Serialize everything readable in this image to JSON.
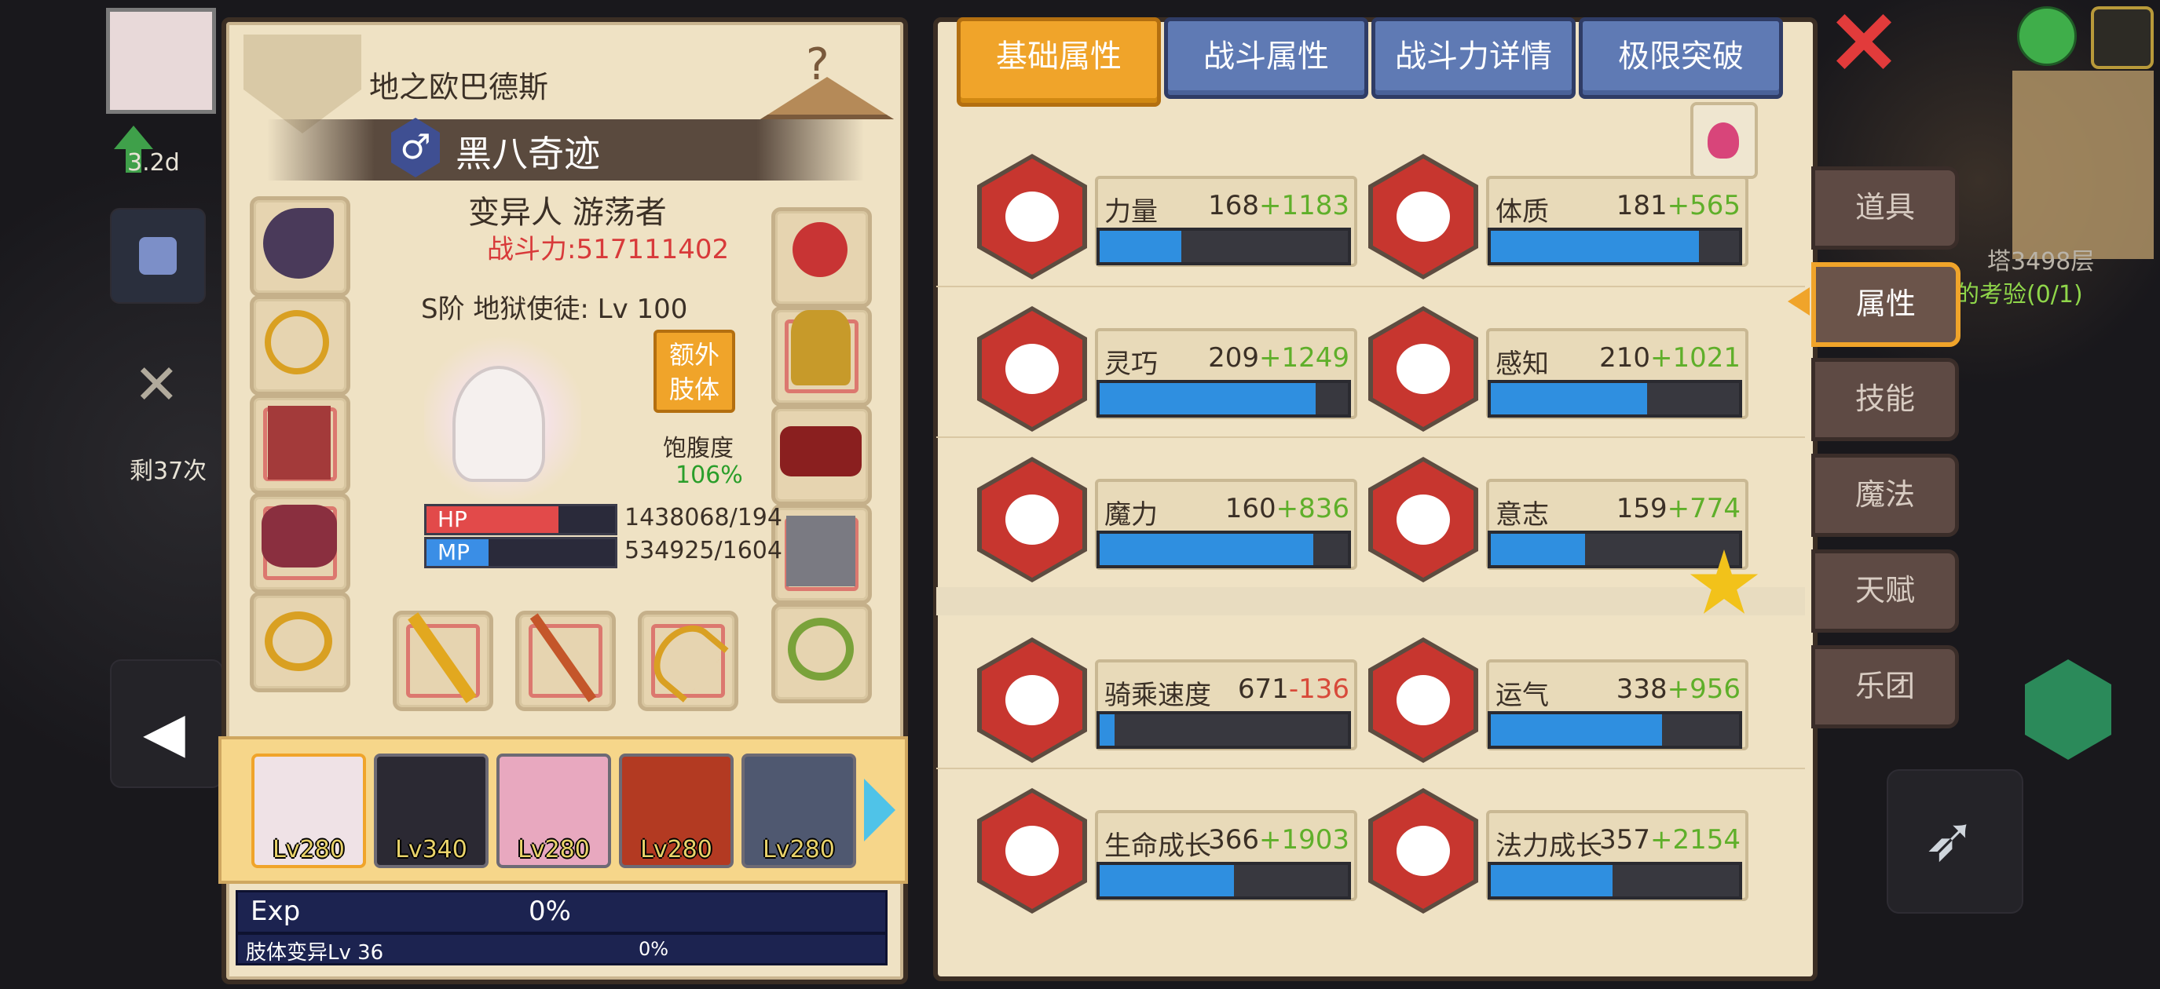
{
  "world": {
    "timer": "3.2d",
    "uses_left": "剩37次",
    "tower_floor": "塔3498层",
    "trial": "的考验(0/1)"
  },
  "character": {
    "title": "地之欧巴德斯",
    "name": "黑八奇迹",
    "gender_symbol": "♂",
    "class_line": "变异人 游荡者",
    "power": "战斗力:517111402",
    "rank_line": "S阶 地狱使徒: Lv 100",
    "extra_limb_btn": "额外\n肢体",
    "satiety_label": "饱腹度",
    "satiety_value": "106%",
    "hp_label": "HP",
    "hp_value": "1438068/194",
    "hp_fraction": 0.7,
    "mp_label": "MP",
    "mp_value": "534925/1604",
    "mp_fraction": 0.33
  },
  "roster": [
    {
      "level": "Lv280"
    },
    {
      "level": "Lv340"
    },
    {
      "level": "Lv280"
    },
    {
      "level": "Lv280"
    },
    {
      "level": "Lv280"
    }
  ],
  "exp": {
    "label": "Exp",
    "value": "0%",
    "sub_label": "肢体变异Lv 36",
    "sub_value": "0%"
  },
  "tabs": [
    "基础属性",
    "战斗属性",
    "战斗力详情",
    "极限突破"
  ],
  "active_tab": 0,
  "stats": [
    {
      "name": "力量",
      "base": "168",
      "bonus": "+1183",
      "bonus_type": "pos",
      "icon": "muscle-arm-icon",
      "fill": 0.33
    },
    {
      "name": "体质",
      "base": "181",
      "bonus": "+565",
      "bonus_type": "pos",
      "icon": "body-torso-icon",
      "fill": 0.84
    },
    {
      "name": "灵巧",
      "base": "209",
      "bonus": "+1249",
      "bonus_type": "pos",
      "icon": "running-man-icon",
      "fill": 0.87
    },
    {
      "name": "感知",
      "base": "210",
      "bonus": "+1021",
      "bonus_type": "pos",
      "icon": "eye-icon",
      "fill": 0.63
    },
    {
      "name": "魔力",
      "base": "160",
      "bonus": "+836",
      "bonus_type": "pos",
      "icon": "magic-swirl-icon",
      "fill": 0.86
    },
    {
      "name": "意志",
      "base": "159",
      "bonus": "+774",
      "bonus_type": "pos",
      "icon": "will-head-icon",
      "fill": 0.38
    },
    {
      "name": "骑乘速度",
      "base": "671",
      "bonus": "-136",
      "bonus_type": "neg",
      "icon": "speed-wing-icon",
      "fill": 0.06
    },
    {
      "name": "运气",
      "base": "338",
      "bonus": "+956",
      "bonus_type": "pos",
      "icon": "clover-icon",
      "fill": 0.69
    },
    {
      "name": "生命成长",
      "base": "366",
      "bonus": "+1903",
      "bonus_type": "pos",
      "icon": "heart-growth-icon",
      "fill": 0.54
    },
    {
      "name": "法力成长",
      "base": "357",
      "bonus": "+2154",
      "bonus_type": "pos",
      "icon": "mana-star-icon",
      "fill": 0.49
    }
  ],
  "side_tabs": [
    "道具",
    "属性",
    "技能",
    "魔法",
    "天赋",
    "乐团"
  ],
  "active_side_tab": 1,
  "colors": {
    "panel": "#efe2c4",
    "tab_active": "#f0a42a",
    "tab_inactive": "#5f7ab4",
    "stat_hex": "#c7362f",
    "bar_fill": "#2f8fe0",
    "bonus_positive": "#5faf2a",
    "bonus_negative": "#d84a3a",
    "power_text": "#d83a3a"
  }
}
